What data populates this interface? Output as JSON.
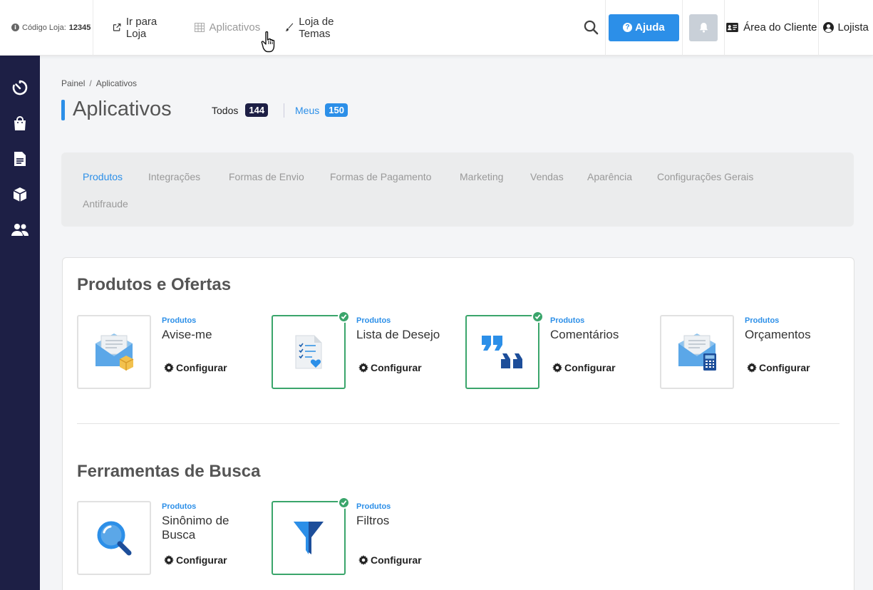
{
  "topbar": {
    "store_code_label": "Código Loja:",
    "store_code": "12345",
    "go_to_store": "Ir para Loja",
    "apps": "Aplicativos",
    "themes": "Loja de Temas",
    "help": "Ajuda",
    "client_area": "Área do Cliente",
    "user": "Lojista"
  },
  "breadcrumb": {
    "home": "Painel",
    "current": "Aplicativos"
  },
  "page": {
    "title": "Aplicativos",
    "all_label": "Todos",
    "all_count": "144",
    "mine_label": "Meus",
    "mine_count": "150"
  },
  "categories": [
    "Produtos",
    "Integrações",
    "Formas de Envio",
    "Formas de Pagamento",
    "Marketing",
    "Vendas",
    "Aparência",
    "Configurações Gerais",
    "Antifraude"
  ],
  "sections": [
    {
      "title": "Produtos e Ofertas",
      "apps": [
        {
          "category": "Produtos",
          "name": "Avise-me",
          "action": "Configurar",
          "installed": false,
          "icon": "envelope-box-icon"
        },
        {
          "category": "Produtos",
          "name": "Lista de Desejo",
          "action": "Configurar",
          "installed": true,
          "icon": "wishlist-icon"
        },
        {
          "category": "Produtos",
          "name": "Comentários",
          "action": "Configurar",
          "installed": true,
          "icon": "quotes-icon"
        },
        {
          "category": "Produtos",
          "name": "Orçamentos",
          "action": "Configurar",
          "installed": false,
          "icon": "envelope-calculator-icon"
        }
      ]
    },
    {
      "title": "Ferramentas de Busca",
      "apps": [
        {
          "category": "Produtos",
          "name": "Sinônimo de Busca",
          "action": "Configurar",
          "installed": false,
          "icon": "magnifier-icon"
        },
        {
          "category": "Produtos",
          "name": "Filtros",
          "action": "Configurar",
          "installed": true,
          "icon": "funnel-icon"
        }
      ]
    }
  ],
  "colors": {
    "accent": "#2c8fe8",
    "sidebar": "#1d1f45",
    "installed": "#3aa56b"
  }
}
